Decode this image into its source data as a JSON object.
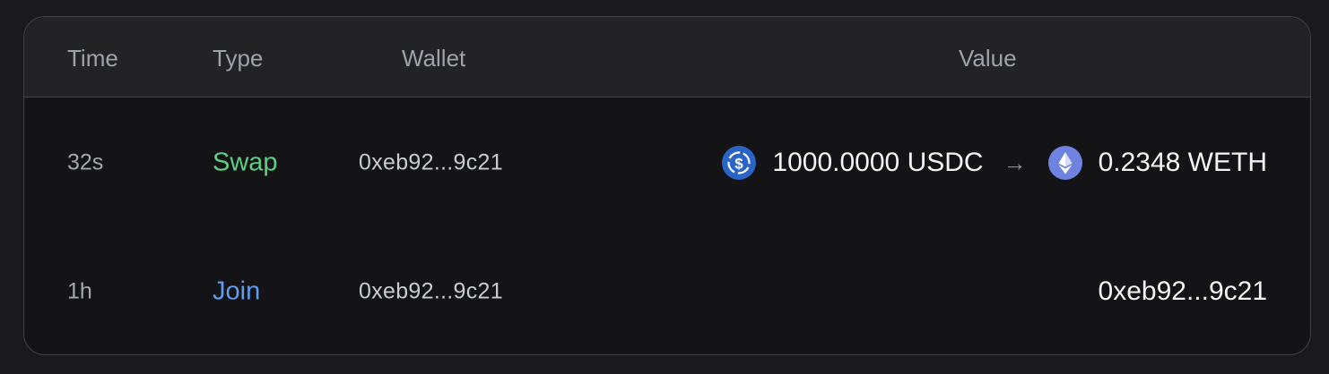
{
  "table": {
    "columns": {
      "time": "Time",
      "type": "Type",
      "wallet": "Wallet",
      "value": "Value"
    },
    "rows": [
      {
        "time": "32s",
        "type": "Swap",
        "type_color": "#5ccf84",
        "wallet": "0xeb92...9c21",
        "value": {
          "from_icon": "usdc-icon",
          "from_amount": "1000.0000 USDC",
          "arrow": "→",
          "to_icon": "weth-icon",
          "to_amount": "0.2348 WETH"
        }
      },
      {
        "time": "1h",
        "type": "Join",
        "type_color": "#5e9cf0",
        "wallet": "0xeb92...9c21",
        "value_text": "0xeb92...9c21"
      }
    ]
  },
  "colors": {
    "background": "#1a1a1d",
    "card": "#141416",
    "header": "#232326",
    "border": "#414248",
    "usdc": "#2a64c4",
    "weth": "#6f82df"
  }
}
